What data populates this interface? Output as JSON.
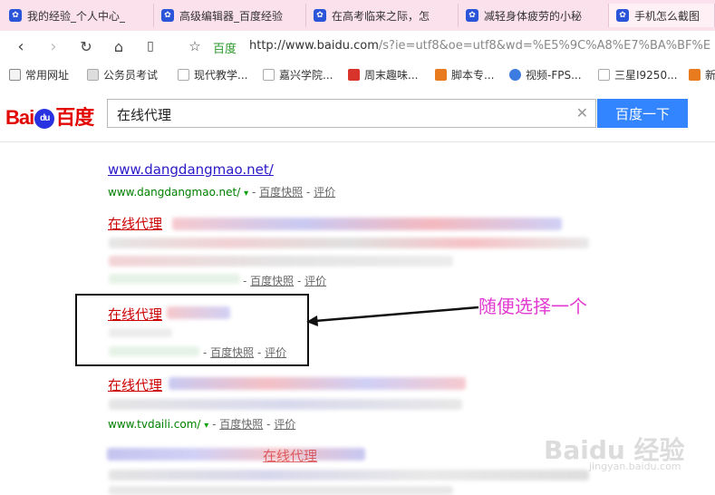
{
  "tabs": [
    {
      "title": "我的经验_个人中心_"
    },
    {
      "title": "高级编辑器_百度经验"
    },
    {
      "title": "在高考临来之际，怎"
    },
    {
      "title": "减轻身体疲劳的小秘"
    },
    {
      "title": "手机怎么截图"
    }
  ],
  "nav": {
    "site_label": "百度",
    "url_host": "http://www.baidu.com",
    "url_rest": "/s?ie=utf8&oe=utf8&wd=%E5%9C%A8%E7%BA%BF%E"
  },
  "bookmarks": [
    {
      "label": "常用网址",
      "icon": "folder-icon"
    },
    {
      "label": "公务员考试",
      "icon": "page-icon"
    },
    {
      "label": "现代教学...",
      "icon": "page-icon"
    },
    {
      "label": "嘉兴学院...",
      "icon": "page-icon"
    },
    {
      "label": "周末趣味...",
      "icon": "red-icon"
    },
    {
      "label": "脚本专...",
      "icon": "orange-icon"
    },
    {
      "label": "视频-FPS...",
      "icon": "play-icon"
    },
    {
      "label": "三星I9250...",
      "icon": "page-icon"
    },
    {
      "label": "新",
      "icon": "orange-icon"
    }
  ],
  "search": {
    "logo_left": "Bai",
    "logo_mid": "du",
    "logo_right": "百度",
    "query": "在线代理",
    "button": "百度一下"
  },
  "results": {
    "r1": {
      "title": "www.dangdangmao.net/",
      "url": "www.dangdangmao.net/",
      "snapshot": "百度快照",
      "review": "评价"
    },
    "r2": {
      "title": "在线代理",
      "snapshot": "百度快照",
      "review": "评价"
    },
    "r3": {
      "title": "在线代理",
      "snapshot": "百度快照",
      "review": "评价"
    },
    "r4": {
      "title": "在线代理",
      "url": "www.tvdaili.com/",
      "snapshot": "百度快照",
      "review": "评价"
    },
    "r5": {
      "title": "在线代理"
    },
    "separator": " - ",
    "arrow": "▾"
  },
  "annotation": {
    "text": "随便选择一个"
  },
  "watermark": {
    "text": "Baidu 经验",
    "sub": "jingyan.baidu.com"
  },
  "colors": {
    "accent": "#3385ff",
    "link": "#2a18c8",
    "title_red": "#c00",
    "url_green": "#008000",
    "annotation": "#e23ad1"
  }
}
